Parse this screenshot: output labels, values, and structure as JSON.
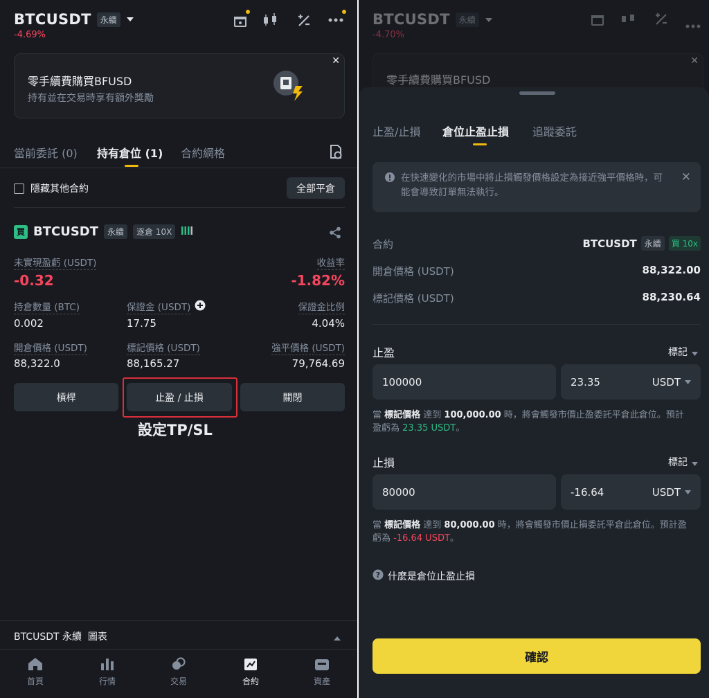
{
  "left": {
    "header": {
      "symbol": "BTCUSDT",
      "type_tag": "永續",
      "change": "-4.69%"
    },
    "banner": {
      "title": "零手續費購買BFUSD",
      "subtitle": "持有並在交易時享有額外獎勵"
    },
    "tabs": [
      {
        "label": "當前委託 (0)"
      },
      {
        "label": "持有倉位 (1)"
      },
      {
        "label": "合約網格"
      }
    ],
    "hide_other": "隱藏其他合約",
    "close_all": "全部平倉",
    "position": {
      "side_badge": "買",
      "symbol": "BTCUSDT",
      "type_tag": "永續",
      "margin_tag": "逐倉 10X",
      "pnl_label": "未實現盈虧 (USDT)",
      "pnl_value": "-0.32",
      "roe_label": "收益率",
      "roe_value": "-1.82%",
      "size_label": "持倉數量 (BTC)",
      "size_value": "0.002",
      "margin_label": "保證金 (USDT)",
      "margin_value": "17.75",
      "ratio_label": "保證金比例",
      "ratio_value": "4.04%",
      "entry_label": "開倉價格 (USDT)",
      "entry_value": "88,322.0",
      "mark_label": "標記價格 (USDT)",
      "mark_value": "88,165.27",
      "liq_label": "強平價格 (USDT)",
      "liq_value": "79,764.69"
    },
    "buttons": {
      "leverage": "槓桿",
      "tpsl": "止盈 / 止損",
      "close": "關閉"
    },
    "annotation": "設定TP/SL",
    "footer_chart": "BTCUSDT 永續  圖表",
    "nav": [
      {
        "label": "首頁"
      },
      {
        "label": "行情"
      },
      {
        "label": "交易"
      },
      {
        "label": "合約"
      },
      {
        "label": "資產"
      }
    ]
  },
  "right": {
    "header": {
      "symbol": "BTCUSDT",
      "type_tag": "永續",
      "change": "-4.70%"
    },
    "banner_title": "零手續費購買BFUSD",
    "tabs": [
      {
        "label": "止盈/止損"
      },
      {
        "label": "倉位止盈止損"
      },
      {
        "label": "追蹤委託"
      }
    ],
    "warning": "在快速變化的市場中將止損觸發價格設定為接近強平價格時，可能會導致訂單無法執行。",
    "contract_label": "合約",
    "contract_value": "BTCUSDT",
    "contract_tag": "永續",
    "contract_side": "買 10x",
    "entry_label": "開倉價格 (USDT)",
    "entry_value": "88,322.00",
    "mark_label": "標記價格 (USDT)",
    "mark_value": "88,230.64",
    "tp": {
      "label": "止盈",
      "mode": "標記",
      "price": "100000",
      "amount": "23.35",
      "unit": "USDT",
      "note_a": "當 ",
      "note_b": "標記價格",
      "note_c": " 達到 ",
      "note_d": "100,000.00",
      "note_e": " 時，將會觸發市價止盈委託平倉此倉位。預計盈虧為 ",
      "note_f": "23.35 USDT",
      "note_g": "。"
    },
    "sl": {
      "label": "止損",
      "mode": "標記",
      "price": "80000",
      "amount": "-16.64",
      "unit": "USDT",
      "note_a": "當 ",
      "note_b": "標記價格",
      "note_c": " 達到 ",
      "note_d": "80,000.00",
      "note_e": " 時，將會觸發市價止損委託平倉此倉位。預計盈虧為 ",
      "note_f": "-16.64 USDT",
      "note_g": "。"
    },
    "help": "什麼是倉位止盈止損",
    "confirm": "確認"
  }
}
